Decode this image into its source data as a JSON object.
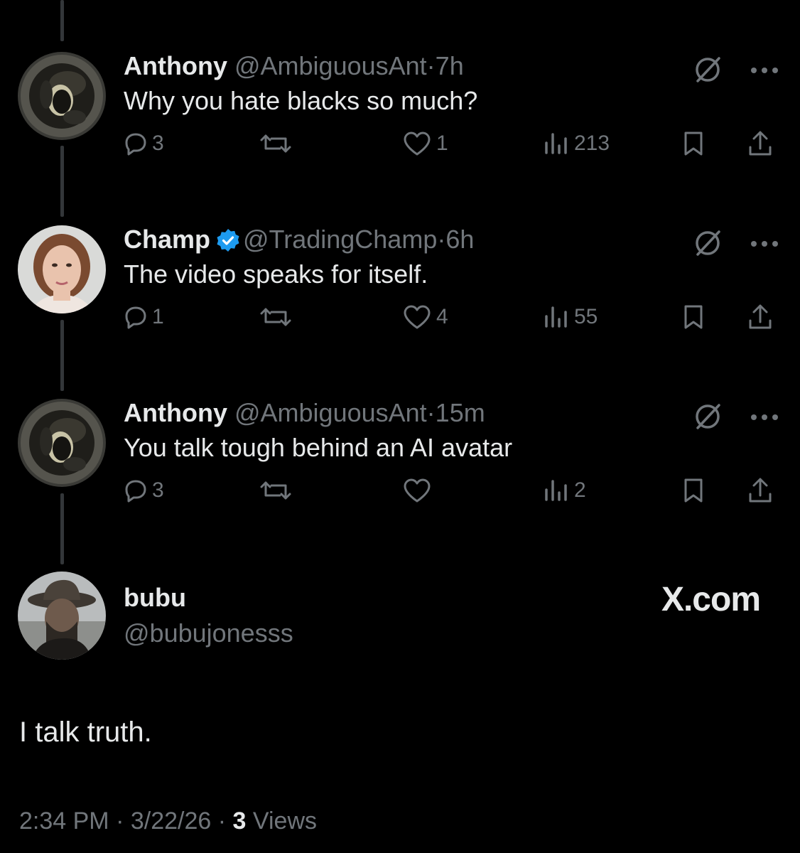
{
  "replies": [
    {
      "name": "Anthony",
      "handle": "@AmbiguousAnt",
      "dot": "·",
      "time": "7h",
      "text": "Why you hate blacks so much?",
      "verified": false,
      "avatar": "avatar-anthony",
      "stats": {
        "replies": "3",
        "reposts": "",
        "likes": "1",
        "views": "213"
      }
    },
    {
      "name": "Champ",
      "handle": "@TradingChamp",
      "dot": "·",
      "time": "6h",
      "text": "The video speaks for itself.",
      "verified": true,
      "avatar": "avatar-champ",
      "stats": {
        "replies": "1",
        "reposts": "",
        "likes": "4",
        "views": "55"
      }
    },
    {
      "name": "Anthony",
      "handle": "@AmbiguousAnt",
      "dot": "·",
      "time": "15m",
      "text": "You talk tough behind an AI avatar",
      "verified": false,
      "avatar": "avatar-anthony",
      "stats": {
        "replies": "3",
        "reposts": "",
        "likes": "",
        "views": "2"
      }
    }
  ],
  "main_post": {
    "name": "bubu",
    "handle": "@bubujonesss",
    "text": "I talk truth.",
    "time": "2:34 PM",
    "dot1": "·",
    "date": "3/22/26",
    "dot2": "·",
    "views_count": "3",
    "views_label": "Views",
    "avatar": "avatar-bubu"
  },
  "watermark": "X.com",
  "icons": {
    "reply": "reply-icon",
    "repost": "repost-icon",
    "like": "like-icon",
    "views": "views-icon",
    "bookmark": "bookmark-icon",
    "share": "share-icon",
    "grok": "grok-icon",
    "more": "more-icon",
    "verified": "verified-badge-icon"
  },
  "colors": {
    "background": "#000000",
    "text_primary": "#e7e9ea",
    "text_secondary": "#71767b",
    "verified_blue": "#1d9bf0",
    "thread_line": "#333639"
  }
}
